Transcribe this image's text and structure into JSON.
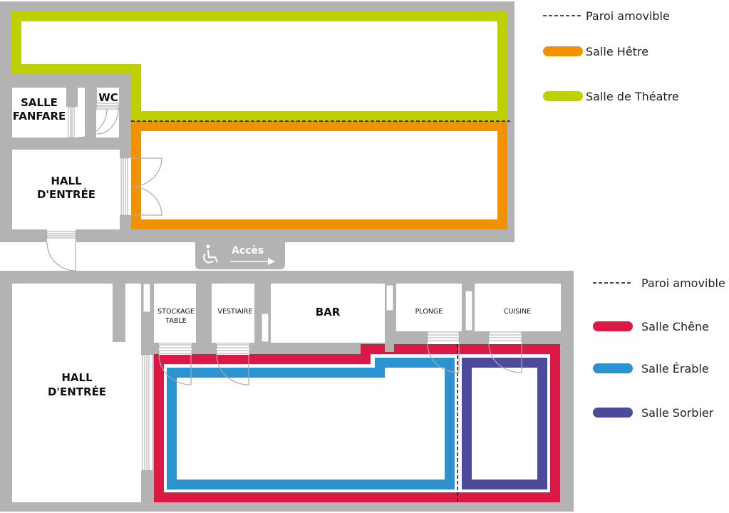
{
  "colors": {
    "wall": "#b3b3b3",
    "theatre": "#bed000",
    "hetre": "#f39200",
    "chene": "#dc1846",
    "erable": "#2b93cf",
    "sorbier": "#4c4a9b"
  },
  "top": {
    "rooms": {
      "fanfare": [
        "SALLE",
        "FANFARE"
      ],
      "wc": "WC",
      "hall": [
        "HALL",
        "D'ENTRÉE"
      ]
    },
    "access": {
      "label": "Accès",
      "icon": "wheelchair-icon"
    },
    "legend": [
      {
        "type": "dashed",
        "label": "Paroi amovible"
      },
      {
        "type": "hetre",
        "label": "Salle Hêtre"
      },
      {
        "type": "theatre",
        "label": "Salle de Théatre"
      }
    ]
  },
  "bottom": {
    "rooms": {
      "hall": [
        "HALL",
        "D'ENTRÉE"
      ],
      "stockage": [
        "STOCKAGE",
        "TABLE"
      ],
      "vestiaire": "VESTIAIRE",
      "bar": "BAR",
      "plonge": "PLONGE",
      "cuisine": "CUISINE"
    },
    "legend": [
      {
        "type": "dashed",
        "label": "Paroi amovible"
      },
      {
        "type": "chene",
        "label": "Salle Chêne"
      },
      {
        "type": "erable",
        "label": "Salle Érable"
      },
      {
        "type": "sorbier",
        "label": "Salle Sorbier"
      }
    ]
  }
}
